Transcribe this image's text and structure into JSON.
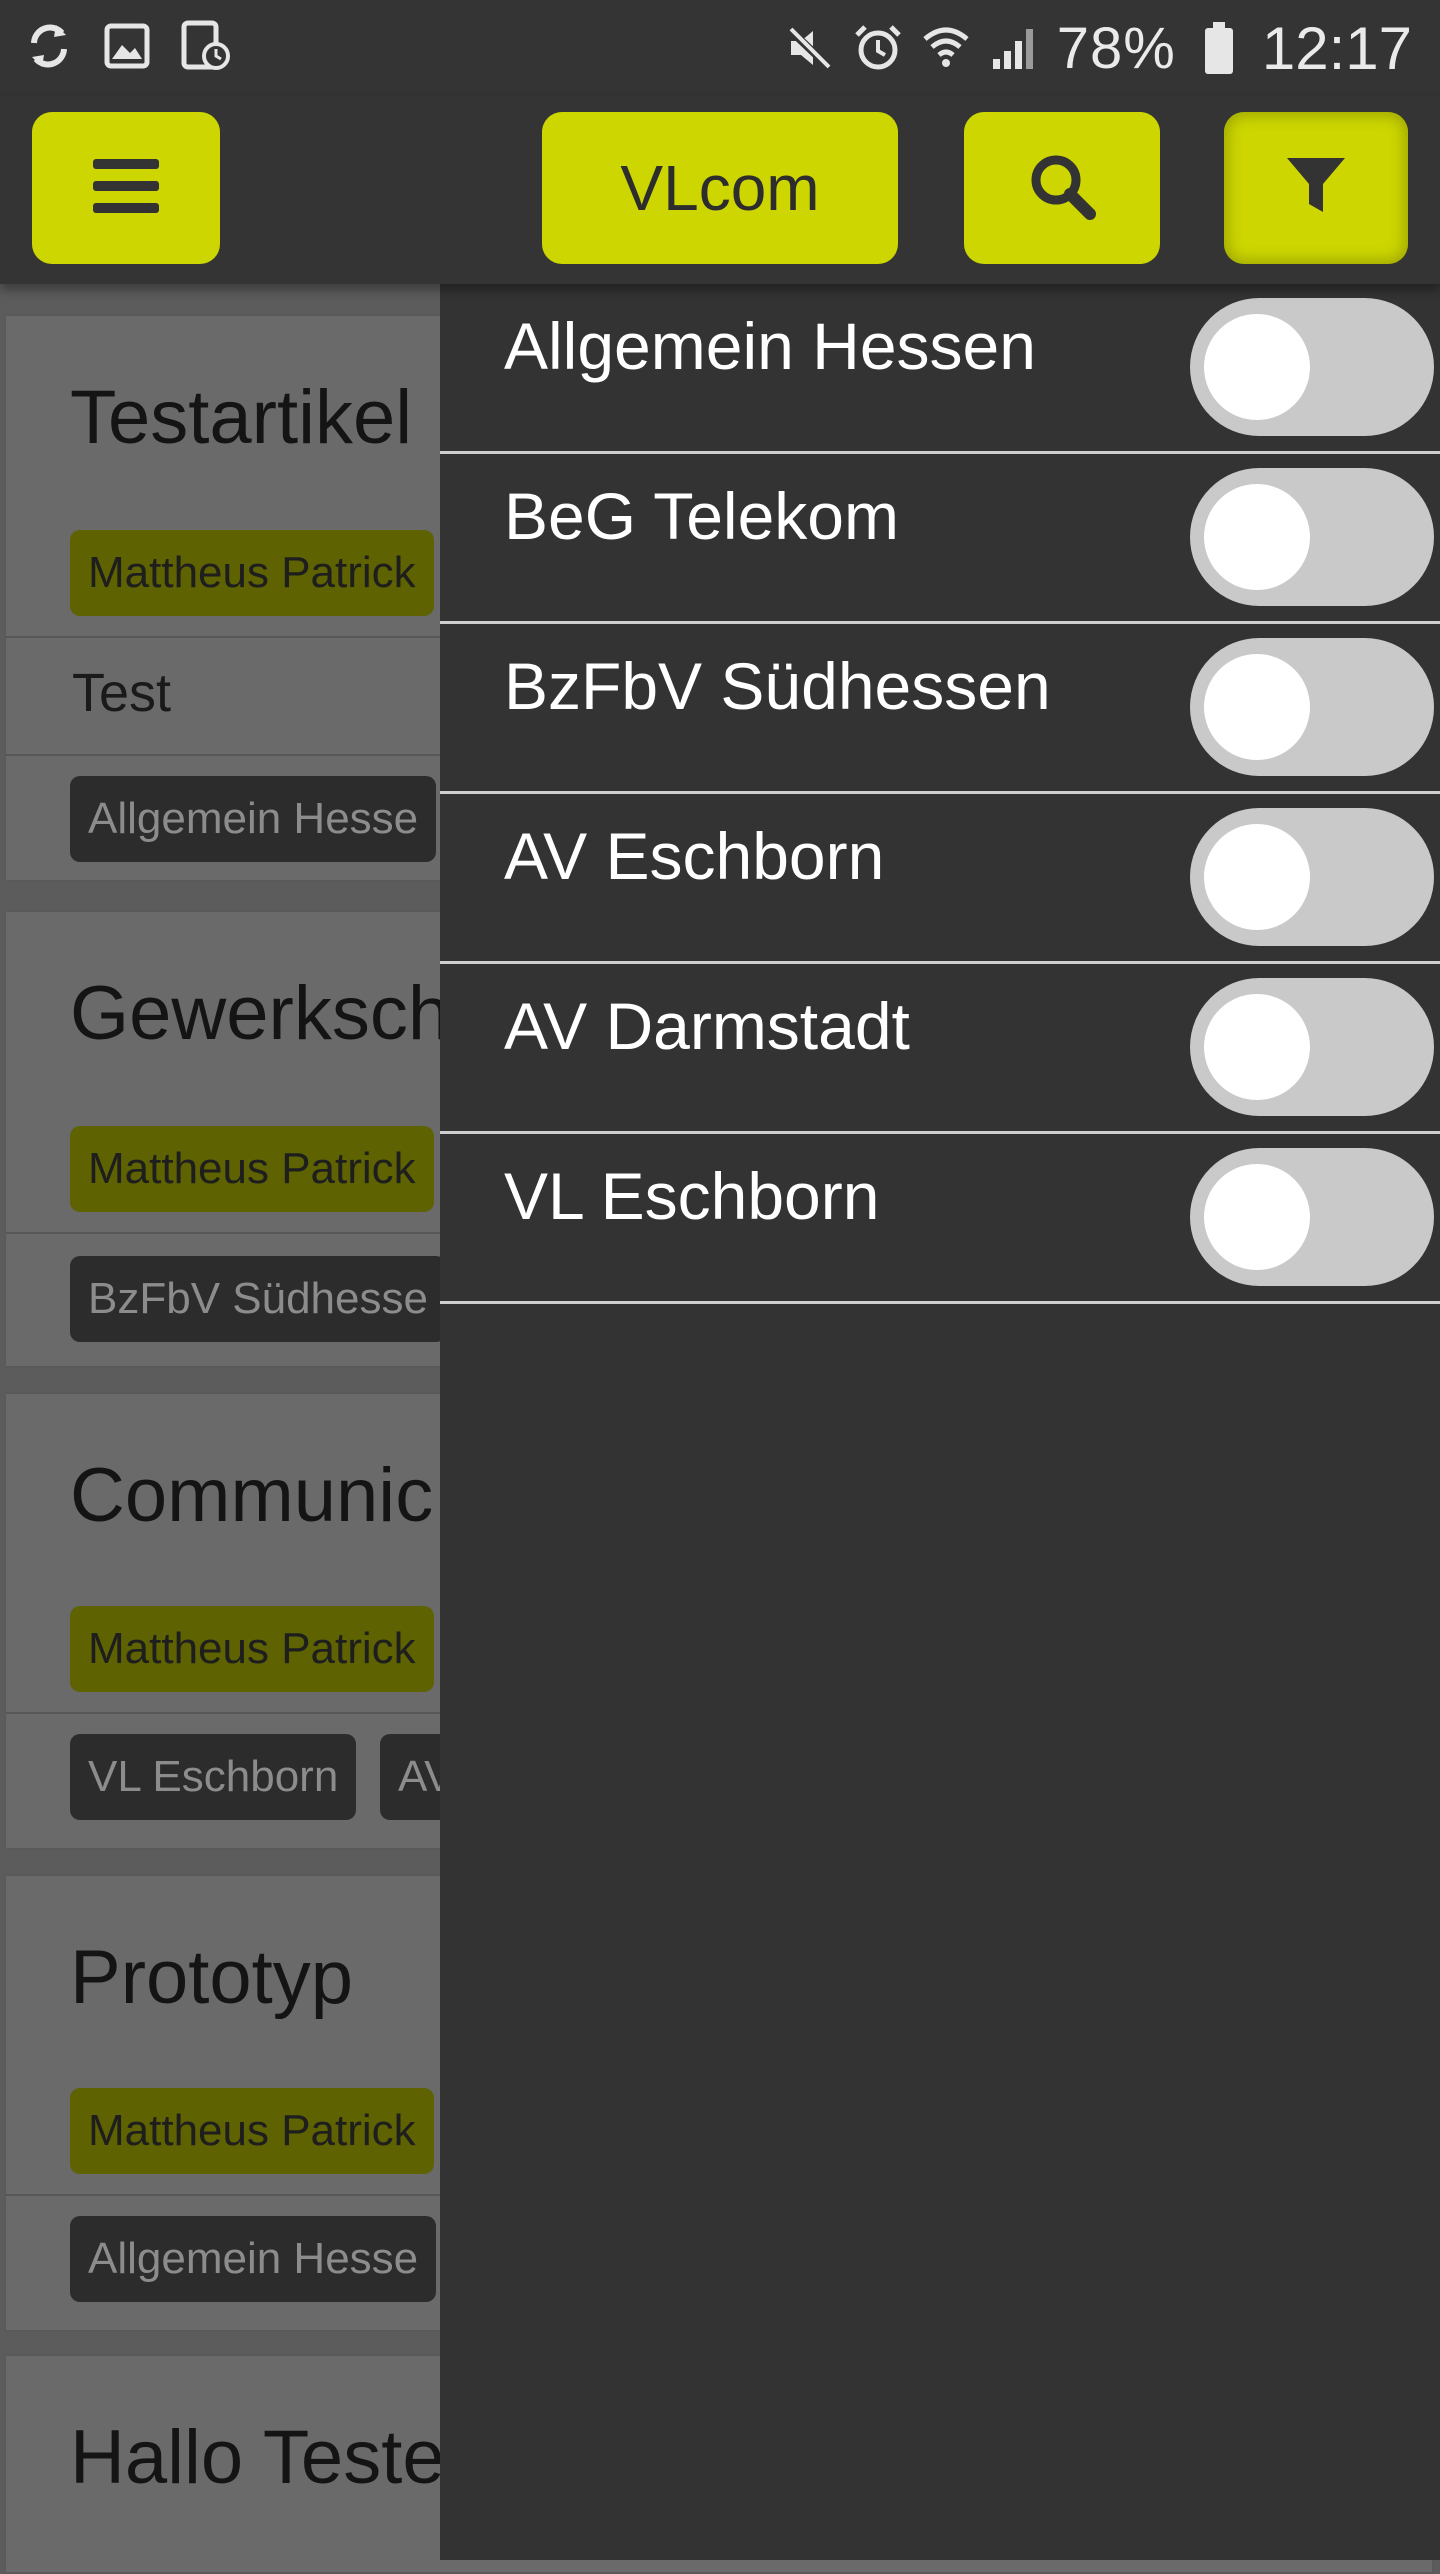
{
  "status_bar": {
    "left_icons": [
      "sync-icon",
      "image-icon",
      "screenshot-icon"
    ],
    "right_icons": [
      "mute-icon",
      "alarm-icon",
      "wifi-icon",
      "signal-icon"
    ],
    "battery": "78%",
    "time": "12:17"
  },
  "header": {
    "menu_icon": "hamburger-menu-icon",
    "brand_label": "VLcom",
    "search_icon": "search-icon",
    "filter_icon": "filter-icon",
    "accent_color": "#cdd600"
  },
  "articles": [
    {
      "title": "Testartikel",
      "author": "Mattheus Patrick",
      "text": "Test",
      "groups": [
        "Allgemein Hesse"
      ]
    },
    {
      "title": "Gewerksch",
      "author": "Mattheus Patrick",
      "text": "",
      "groups": [
        "BzFbV Südhesse"
      ]
    },
    {
      "title": "Communic",
      "author": "Mattheus Patrick",
      "text": "",
      "groups": [
        "VL Eschborn",
        "AV"
      ]
    },
    {
      "title": "Prototyp",
      "author": "Mattheus Patrick",
      "text": "",
      "groups": [
        "Allgemein Hesse"
      ]
    },
    {
      "title": "Hallo Teste",
      "author": "",
      "text": "",
      "groups": []
    }
  ],
  "filters": [
    {
      "label": "Allgemein Hessen",
      "enabled": false
    },
    {
      "label": "BeG Telekom",
      "enabled": false
    },
    {
      "label": "BzFbV Südhessen",
      "enabled": false
    },
    {
      "label": "AV Eschborn",
      "enabled": false
    },
    {
      "label": "AV Darmstadt",
      "enabled": false
    },
    {
      "label": "VL Eschborn",
      "enabled": false
    }
  ]
}
